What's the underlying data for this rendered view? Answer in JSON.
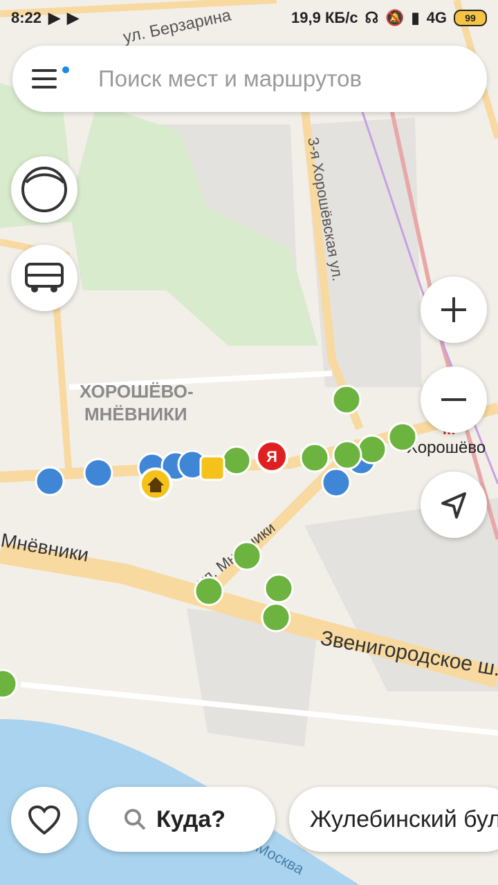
{
  "status_bar": {
    "time": "8:22",
    "network_speed": "19,9 КБ/с",
    "network_type": "4G",
    "battery": "99"
  },
  "search": {
    "placeholder": "Поиск мест и маршрутов"
  },
  "map": {
    "streets": {
      "berzarina": "ул. Берзарина",
      "third_khoroshevskaya": "3-я Хорошёвская ул.",
      "mnevniki_left": "Мнёвники",
      "mnevniki_street": "ул. Мнёвники",
      "zvenigorodskoe": "Звенигородское ш.",
      "moskva_river": "Москва"
    },
    "district": {
      "line1": "ХОРОШЁВО-",
      "line2": "МНЁВНИКИ"
    },
    "metro_station": "Хорошёво",
    "user_marker_label": "Я",
    "colors": {
      "bus_marker": "#6cb33f",
      "trolleybus_marker": "#3f87d6",
      "user_marker": "#e02020",
      "home_marker": "#f5c21b"
    }
  },
  "bottom": {
    "where_label": "Куда?",
    "route_label": "Жулебинский бульвар"
  },
  "icons": {
    "menu": "menu-icon",
    "profile": "profile-icon",
    "transport": "bus-icon",
    "zoom_in": "plus-icon",
    "zoom_out": "minus-icon",
    "locate": "location-arrow-icon",
    "favorites": "heart-icon",
    "search": "search-icon"
  }
}
